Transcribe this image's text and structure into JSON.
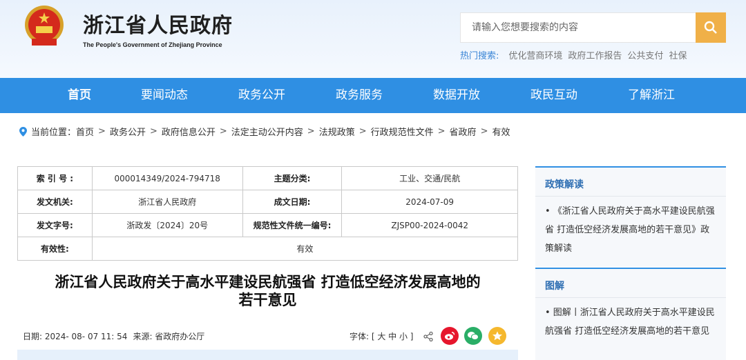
{
  "header": {
    "title": "浙江省人民政府",
    "subtitle": "The People's Government of Zhejiang Province",
    "search_placeholder": "请输入您想要搜索的内容",
    "hot_label": "热门搜索:",
    "hot_items": [
      "优化营商环境",
      "政府工作报告",
      "公共支付",
      "社保"
    ]
  },
  "nav": [
    "首页",
    "要闻动态",
    "政务公开",
    "政务服务",
    "数据开放",
    "政民互动",
    "了解浙江"
  ],
  "breadcrumb": {
    "prefix": "当前位置：",
    "items": [
      "首页",
      "政务公开",
      "政府信息公开",
      "法定主动公开内容",
      "法规政策",
      "行政规范性文件",
      "省政府",
      "有效"
    ]
  },
  "meta": {
    "index_label": "索 引 号 :",
    "index_value": "000014349/2024-794718",
    "topic_label": "主题分类:",
    "topic_value": "工业、交通/民航",
    "issuer_label": "发文机关:",
    "issuer_value": "浙江省人民政府",
    "date_label": "成文日期:",
    "date_value": "2024-07-09",
    "docno_label": "发文字号:",
    "docno_value": "浙政发〔2024〕20号",
    "code_label": "规范性文件统一编号:",
    "code_value": "ZJSP00-2024-0042",
    "valid_label": "有效性:",
    "valid_value": "有效"
  },
  "article": {
    "title_line1": "浙江省人民政府关于高水平建设民航强省 打造低空经济发展高地的",
    "title_line2": "若干意见",
    "date_text": "日期:  2024- 08- 07 11: 54",
    "source_text": "来源:  省政府办公厅",
    "font_text": "字体: [ 大 中 小 ]"
  },
  "sidebar": {
    "policy_title": "政策解读",
    "policy_item": "• 《浙江省人民政府关于高水平建设民航强省 打造低空经济发展高地的若干意见》政策解读",
    "graphic_title": "图解",
    "graphic_item": "• 图解丨浙江省人民政府关于高水平建设民航强省 打造低空经济发展高地的若干意见"
  },
  "colors": {
    "nav": "#2f8fe3",
    "search_button": "#f0b048",
    "weibo": "#e6162d",
    "wechat": "#2aae67",
    "favorite": "#f5b82e"
  },
  "icons": [
    "emblem-icon",
    "search-icon",
    "location-pin-icon",
    "share-icon",
    "weibo-icon",
    "wechat-icon",
    "favorite-icon"
  ]
}
